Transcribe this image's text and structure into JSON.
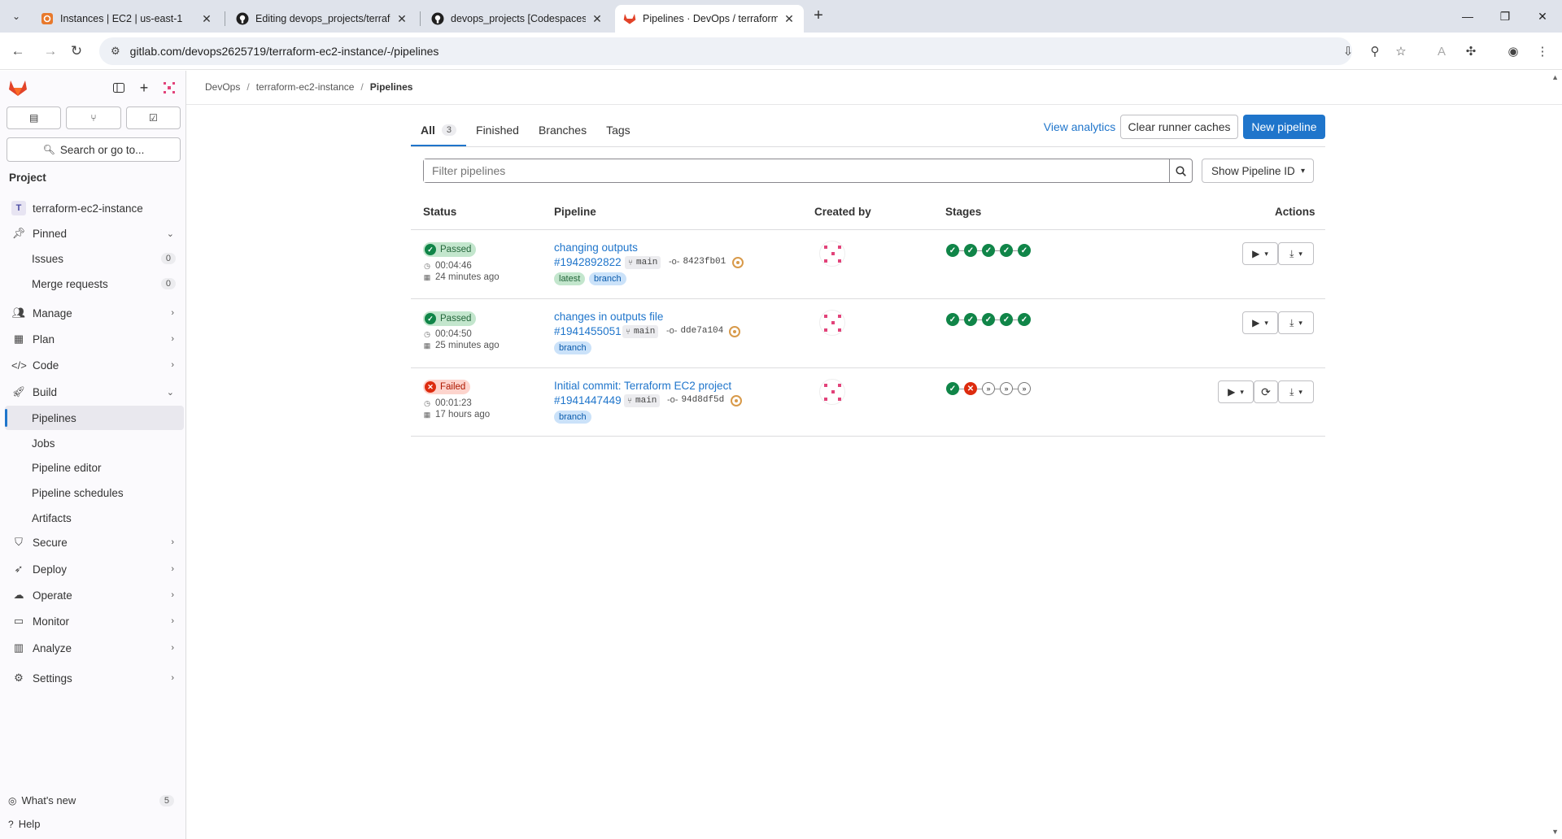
{
  "browser": {
    "tabs": [
      {
        "title": "Instances | EC2 | us-east-1",
        "icon": "aws-icon"
      },
      {
        "title": "Editing devops_projects/terrafo",
        "icon": "github-icon"
      },
      {
        "title": "devops_projects [Codespaces: ",
        "icon": "github-icon"
      },
      {
        "title": "Pipelines · DevOps / terraform-",
        "icon": "gitlab-icon"
      }
    ],
    "url": "gitlab.com/devops2625719/terraform-ec2-instance/-/pipelines"
  },
  "sidebar": {
    "search_label": "Search or go to...",
    "section_label": "Project",
    "project_name": "terraform-ec2-instance",
    "project_initial": "T",
    "pinned_label": "Pinned",
    "pinned_items": [
      {
        "label": "Issues",
        "count": "0"
      },
      {
        "label": "Merge requests",
        "count": "0"
      }
    ],
    "nav": [
      {
        "label": "Manage",
        "icon": "users-icon"
      },
      {
        "label": "Plan",
        "icon": "calendar-icon"
      },
      {
        "label": "Code",
        "icon": "code-icon"
      }
    ],
    "build_label": "Build",
    "build_items": [
      "Pipelines",
      "Jobs",
      "Pipeline editor",
      "Pipeline schedules",
      "Artifacts"
    ],
    "nav2": [
      {
        "label": "Secure",
        "icon": "shield-icon"
      },
      {
        "label": "Deploy",
        "icon": "rocket-icon"
      },
      {
        "label": "Operate",
        "icon": "cloud-icon"
      },
      {
        "label": "Monitor",
        "icon": "monitor-icon"
      },
      {
        "label": "Analyze",
        "icon": "chart-icon"
      },
      {
        "label": "Settings",
        "icon": "gear-icon"
      }
    ],
    "whats_new": "What's new",
    "whats_new_count": "5",
    "help": "Help"
  },
  "breadcrumb": [
    "DevOps",
    "terraform-ec2-instance",
    "Pipelines"
  ],
  "tabs": [
    {
      "label": "All",
      "count": "3"
    },
    {
      "label": "Finished"
    },
    {
      "label": "Branches"
    },
    {
      "label": "Tags"
    }
  ],
  "actions": {
    "view_analytics": "View analytics",
    "clear_caches": "Clear runner caches",
    "new_pipeline": "New pipeline"
  },
  "filter": {
    "placeholder": "Filter pipelines",
    "show_id": "Show Pipeline ID"
  },
  "columns": [
    "Status",
    "Pipeline",
    "Created by",
    "Stages",
    "Actions"
  ],
  "pipelines": [
    {
      "status": "Passed",
      "duration": "00:04:46",
      "finished": "24 minutes ago",
      "title": "changing outputs",
      "id": "#1942892822",
      "ref": "main",
      "sha": "8423fb01",
      "tags": [
        "latest",
        "branch"
      ],
      "stages": [
        "success",
        "success",
        "success",
        "success",
        "success"
      ]
    },
    {
      "status": "Passed",
      "duration": "00:04:50",
      "finished": "25 minutes ago",
      "title": "changes in outputs file",
      "id": "#1941455051",
      "ref": "main",
      "sha": "dde7a104",
      "tags": [
        "branch"
      ],
      "stages": [
        "success",
        "success",
        "success",
        "success",
        "success"
      ]
    },
    {
      "status": "Failed",
      "duration": "00:01:23",
      "finished": "17 hours ago",
      "title": "Initial commit: Terraform EC2 project",
      "id": "#1941447449",
      "ref": "main",
      "sha": "94d8df5d",
      "tags": [
        "branch"
      ],
      "stages": [
        "success",
        "failed",
        "skipped",
        "skipped",
        "skipped"
      ]
    }
  ],
  "colors": {
    "accent": "#1f75cb",
    "success": "#108548",
    "failed": "#dd2b0e",
    "tanuki": "#e24329"
  }
}
